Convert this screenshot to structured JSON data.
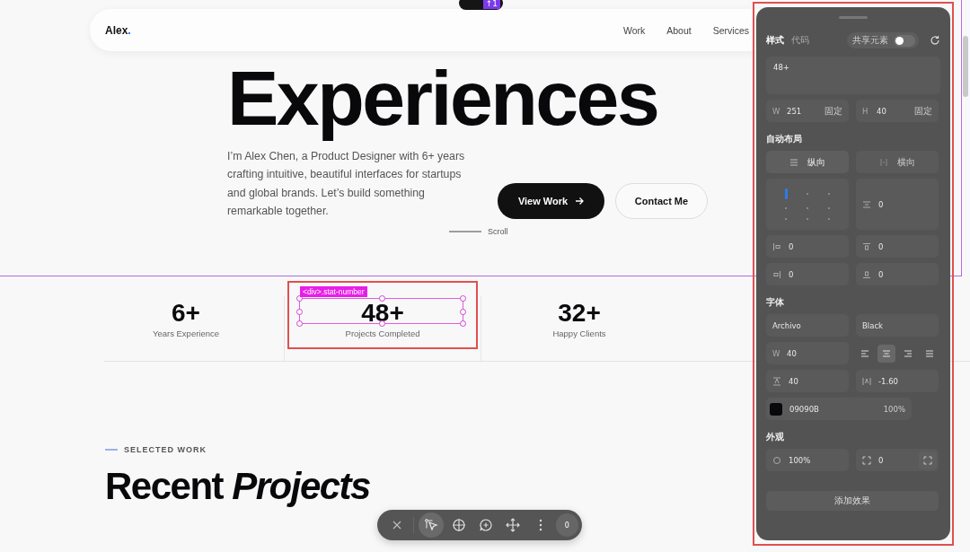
{
  "top_pill": {
    "badge": "↑1"
  },
  "nav": {
    "logo": "Alex",
    "logo_dot": ".",
    "links": [
      {
        "label": "Work"
      },
      {
        "label": "About"
      },
      {
        "label": "Services"
      }
    ]
  },
  "hero": {
    "line_2": "Experiences",
    "intro": "I’m Alex Chen, a Product Designer with 6+ years crafting intuitive, beautiful interfaces for startups and global brands. Let’s build something remarkable together.",
    "buttons": [
      {
        "label": "View Work",
        "kind": "primary"
      },
      {
        "label": "Contact Me",
        "kind": "outline"
      }
    ],
    "scroll": "Scroll"
  },
  "stats": [
    {
      "number": "6+",
      "label": "Years Experience",
      "selected": false
    },
    {
      "number": "48+",
      "label": "Projects Completed",
      "selected": true
    },
    {
      "number": "32+",
      "label": "Happy Clients",
      "selected": false
    }
  ],
  "selection": {
    "tag": "<div>.stat-number"
  },
  "work": {
    "eyebrow": "SELECTED WORK",
    "heading": "Recent *Projects*"
  },
  "toolbar": {
    "tools": [
      {
        "kind": "close",
        "selected": false
      },
      {
        "kind": "pointer",
        "selected": true
      },
      {
        "kind": "grid",
        "selected": false
      },
      {
        "kind": "comment",
        "selected": false
      },
      {
        "kind": "move",
        "selected": false
      },
      {
        "kind": "more",
        "selected": false
      }
    ],
    "count": "0"
  },
  "panel": {
    "tabs": [
      {
        "label": "样式",
        "selected": true
      },
      {
        "label": "代码",
        "selected": false
      }
    ],
    "share": {
      "label": "共享元素",
      "on": false
    },
    "content": "48+",
    "size": [
      {
        "prefix": "W",
        "value": "251",
        "suffix": "固定"
      },
      {
        "prefix": "H",
        "value": "40",
        "suffix": "固定"
      }
    ],
    "layout_title": "自动布局",
    "directions": [
      {
        "label": "纵向",
        "kind": "vertical",
        "selected": true
      },
      {
        "label": "横向",
        "kind": "horizontal",
        "selected": false
      }
    ],
    "alignment": [
      {
        "selected": true
      },
      {
        "selected": false
      },
      {
        "selected": false
      },
      {
        "selected": false
      },
      {
        "selected": false
      },
      {
        "selected": false
      },
      {
        "selected": false
      },
      {
        "selected": false
      },
      {
        "selected": false
      }
    ],
    "gap": {
      "kind": "gap",
      "value": "0"
    },
    "padding": [
      {
        "kind": "pad-left",
        "value": "0"
      },
      {
        "kind": "pad-top",
        "value": "0"
      },
      {
        "kind": "pad-right",
        "value": "0"
      },
      {
        "kind": "pad-bottom",
        "value": "0"
      }
    ],
    "font_title": "字体",
    "font_family": "Archivo",
    "font_weight": "Black",
    "font_size": {
      "prefix": "W",
      "value": "40"
    },
    "text_align": [
      {
        "kind": "left",
        "selected": false
      },
      {
        "kind": "center",
        "selected": true
      },
      {
        "kind": "right",
        "selected": false
      },
      {
        "kind": "justify",
        "selected": false
      }
    ],
    "metrics": [
      {
        "kind": "line-height",
        "value": "40"
      },
      {
        "kind": "letter-spacing",
        "value": "-1.60"
      }
    ],
    "fill": {
      "color": "#09090b",
      "hex": "09090B",
      "opacity": "100%"
    },
    "look_title": "外观",
    "look": [
      {
        "kind": "opacity",
        "value": "100%"
      },
      {
        "kind": "radius",
        "value": "0"
      }
    ],
    "add_effect": "添加效果"
  }
}
